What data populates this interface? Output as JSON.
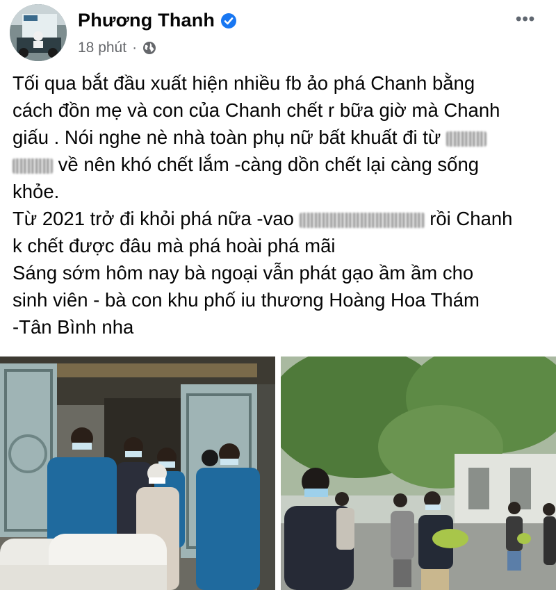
{
  "author": {
    "name": "Phương Thanh",
    "verified": true
  },
  "meta": {
    "time": "18 phút",
    "separator": "·",
    "audience_icon": "globe-icon"
  },
  "menu": {
    "label": "•••"
  },
  "post_lines": [
    "Tối qua bắt đầu xuất hiện nhiều fb ảo phá Chanh bằng",
    "cách đồn mẹ và con của Chanh chết r bữa giờ mà Chanh",
    "giấu . Nói nghe nè nhà toàn phụ nữ bất khuất đi từ",
    "về nên khó chết lắm -càng dồn chết lại càng sống",
    "khỏe.",
    "Từ 2021 trở đi khỏi phá nữa -vao",
    "rồi Chanh",
    "k chết được đâu mà phá hoài phá mãi",
    "Sáng sớm hôm nay bà ngoại vẫn phát gạo ầm ầm cho",
    "sinh viên - bà con khu phố iu thương Hoàng Hoa Thám",
    "-Tân Bình nha"
  ],
  "colors": {
    "verified": "#1877f2",
    "secondary_text": "#65676b",
    "uniform": "#1f6a9e"
  }
}
